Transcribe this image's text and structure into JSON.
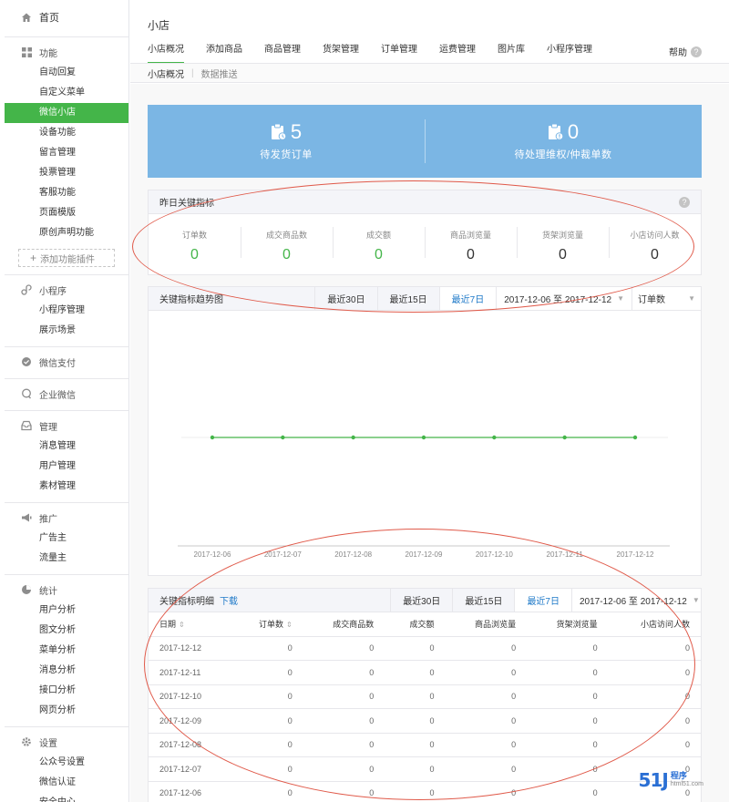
{
  "sidebar": {
    "home": "首页",
    "groups": [
      {
        "head": "功能",
        "icon": "grid-icon",
        "items": [
          "自动回复",
          "自定义菜单",
          "微信小店",
          "设备功能",
          "留言管理",
          "投票管理",
          "客服功能",
          "页面模版",
          "原创声明功能"
        ],
        "active": 2,
        "add": "添加功能插件"
      },
      {
        "head": "小程序",
        "icon": "link-icon",
        "items": [
          "小程序管理",
          "展示场景"
        ]
      },
      {
        "head": "微信支付",
        "icon": "wallet-icon",
        "items": []
      },
      {
        "head": "企业微信",
        "icon": "chat-icon",
        "items": []
      },
      {
        "head": "管理",
        "icon": "inbox-icon",
        "items": [
          "消息管理",
          "用户管理",
          "素材管理"
        ]
      },
      {
        "head": "推广",
        "icon": "megaphone-icon",
        "items": [
          "广告主",
          "流量主"
        ]
      },
      {
        "head": "统计",
        "icon": "pie-icon",
        "items": [
          "用户分析",
          "图文分析",
          "菜单分析",
          "消息分析",
          "接口分析",
          "网页分析"
        ]
      },
      {
        "head": "设置",
        "icon": "gear-icon",
        "items": [
          "公众号设置",
          "微信认证",
          "安全中心"
        ]
      }
    ]
  },
  "page": {
    "title": "小店",
    "tabs": [
      "小店概况",
      "添加商品",
      "商品管理",
      "货架管理",
      "订单管理",
      "运费管理",
      "图片库",
      "小程序管理"
    ],
    "help": "帮助",
    "subnav": [
      "小店概况",
      "数据推送"
    ]
  },
  "banner": [
    {
      "value": "5",
      "label": "待发货订单"
    },
    {
      "value": "0",
      "label": "待处理维权/仲裁单数"
    }
  ],
  "yesterday": {
    "title": "昨日关键指标",
    "metrics": [
      {
        "label": "订单数",
        "value": "0"
      },
      {
        "label": "成交商品数",
        "value": "0"
      },
      {
        "label": "成交额",
        "value": "0"
      },
      {
        "label": "商品浏览量",
        "value": "0"
      },
      {
        "label": "货架浏览量",
        "value": "0"
      },
      {
        "label": "小店访问人数",
        "value": "0"
      }
    ]
  },
  "trend": {
    "title": "关键指标趋势图",
    "ranges": [
      "最近30日",
      "最近15日",
      "最近7日"
    ],
    "date_range": "2017-12-06 至 2017-12-12",
    "metric_select": "订单数"
  },
  "chart_data": {
    "type": "line",
    "x": [
      "2017-12-06",
      "2017-12-07",
      "2017-12-08",
      "2017-12-09",
      "2017-12-10",
      "2017-12-11",
      "2017-12-12"
    ],
    "series": [
      {
        "values": [
          0,
          0,
          0,
          0,
          0,
          0,
          0
        ],
        "color": "#44b549"
      }
    ],
    "ylim": [
      -1,
      1
    ],
    "grid": true
  },
  "detail": {
    "title": "关键指标明细",
    "download": "下载",
    "ranges": [
      "最近30日",
      "最近15日",
      "最近7日"
    ],
    "date_range": "2017-12-06 至 2017-12-12",
    "columns": [
      "日期",
      "订单数",
      "成交商品数",
      "成交额",
      "商品浏览量",
      "货架浏览量",
      "小店访问人数"
    ],
    "rows": [
      [
        "2017-12-12",
        "0",
        "0",
        "0",
        "0",
        "0",
        "0"
      ],
      [
        "2017-12-11",
        "0",
        "0",
        "0",
        "0",
        "0",
        "0"
      ],
      [
        "2017-12-10",
        "0",
        "0",
        "0",
        "0",
        "0",
        "0"
      ],
      [
        "2017-12-09",
        "0",
        "0",
        "0",
        "0",
        "0",
        "0"
      ],
      [
        "2017-12-08",
        "0",
        "0",
        "0",
        "0",
        "0",
        "0"
      ],
      [
        "2017-12-07",
        "0",
        "0",
        "0",
        "0",
        "0",
        "0"
      ],
      [
        "2017-12-06",
        "0",
        "0",
        "0",
        "0",
        "0",
        "0"
      ]
    ]
  },
  "watermark": {
    "logo": "51J",
    "line1": "程序",
    "line2": "html51.com"
  },
  "colors": {
    "accent": "#44b549",
    "banner": "#7bb6e4",
    "link": "#1e79c8",
    "annotation": "#e05a4a"
  }
}
